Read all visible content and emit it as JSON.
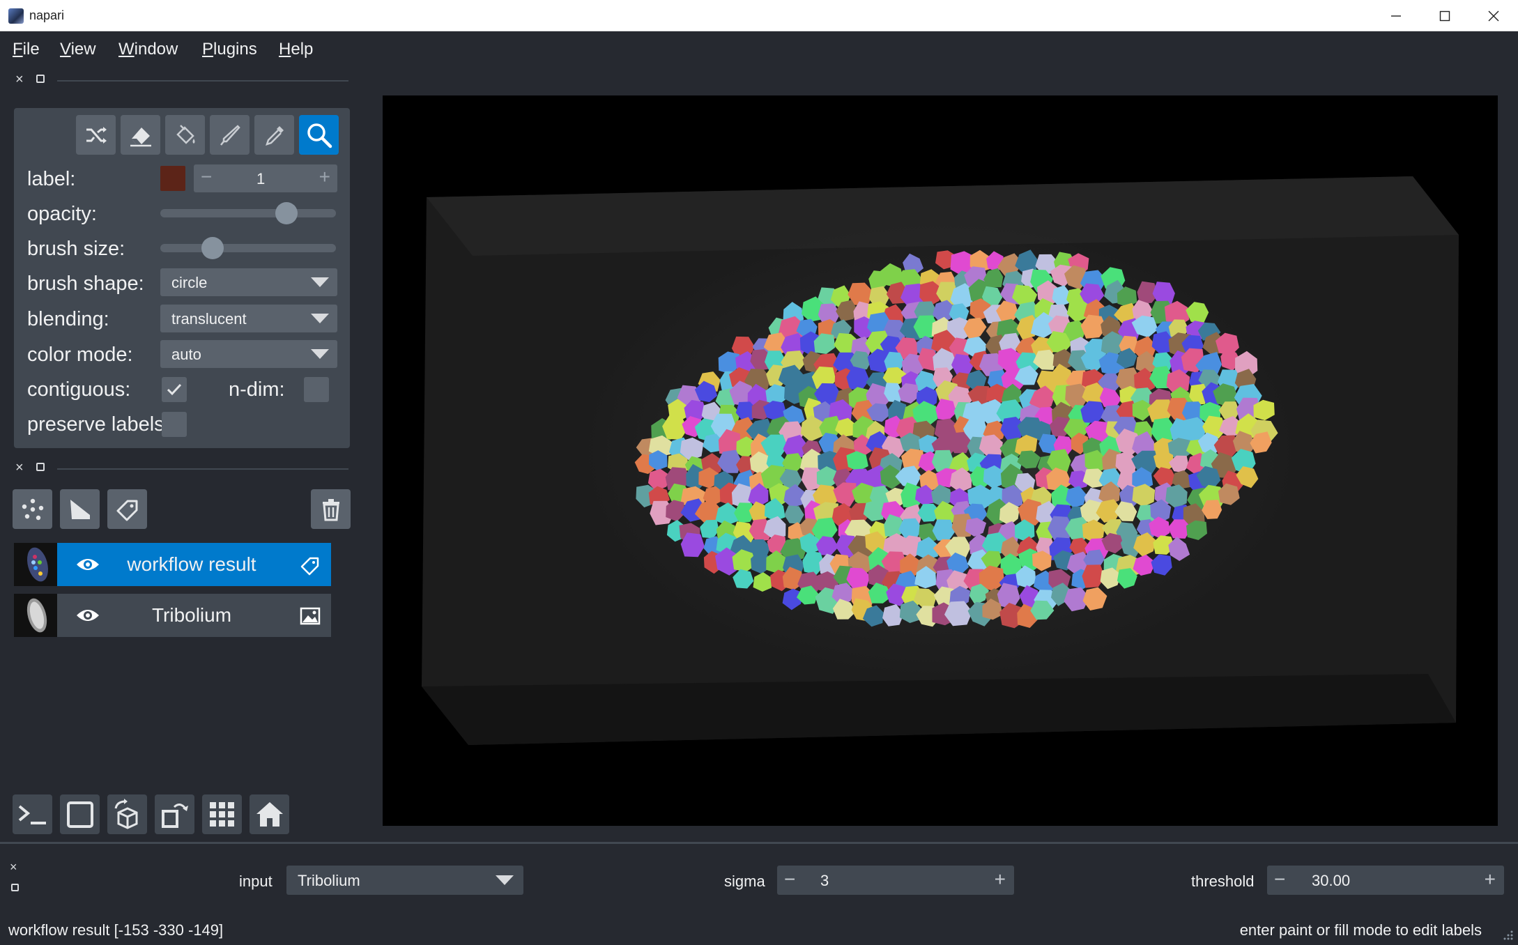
{
  "window": {
    "title": "napari",
    "minimize": "—",
    "maximize": "☐",
    "close": "✕"
  },
  "menu": [
    {
      "label": "File",
      "u": "F",
      "rest": "ile"
    },
    {
      "label": "View",
      "u": "V",
      "rest": "iew"
    },
    {
      "label": "Window",
      "u": "W",
      "rest": "indow"
    },
    {
      "label": "Plugins",
      "u": "P",
      "rest": "lugins"
    },
    {
      "label": "Help",
      "u": "H",
      "rest": "elp"
    }
  ],
  "tools": [
    "shuffle-icon",
    "eraser-icon",
    "fill-icon",
    "paint-brush-icon",
    "color-picker-icon",
    "zoom-icon"
  ],
  "active_tool": "zoom-icon",
  "controls": {
    "label_label": "label:",
    "label_value": "1",
    "label_color": "#5c2418",
    "minus": "−",
    "plus": "+",
    "opacity_label": "opacity:",
    "opacity_value": 0.75,
    "brush_size_label": "brush size:",
    "brush_size_value": 0.27,
    "brush_shape_label": "brush shape:",
    "brush_shape_value": "circle",
    "blending_label": "blending:",
    "blending_value": "translucent",
    "color_mode_label": "color mode:",
    "color_mode_value": "auto",
    "contiguous_label": "contiguous:",
    "contiguous_checked": true,
    "ndim_label": "n-dim:",
    "ndim_checked": false,
    "preserve_label": "preserve labels",
    "preserve_checked": false
  },
  "layers": [
    {
      "name": "workflow result",
      "visible": true,
      "selected": true,
      "type_icon": "labels-icon"
    },
    {
      "name": "Tribolium",
      "visible": true,
      "selected": false,
      "type_icon": "image-icon"
    }
  ],
  "widget": {
    "input_label": "input",
    "input_value": "Tribolium",
    "sigma_label": "sigma",
    "sigma_value": "3",
    "threshold_label": "threshold",
    "threshold_value": "30.00",
    "minus": "−",
    "plus": "+"
  },
  "status": {
    "left": "workflow result [-153 -330 -149]",
    "right": "enter paint or fill mode to edit labels"
  },
  "colors": {
    "accent": "#007acc",
    "background": "#262930",
    "panel": "#414851",
    "control": "#5a626c"
  }
}
